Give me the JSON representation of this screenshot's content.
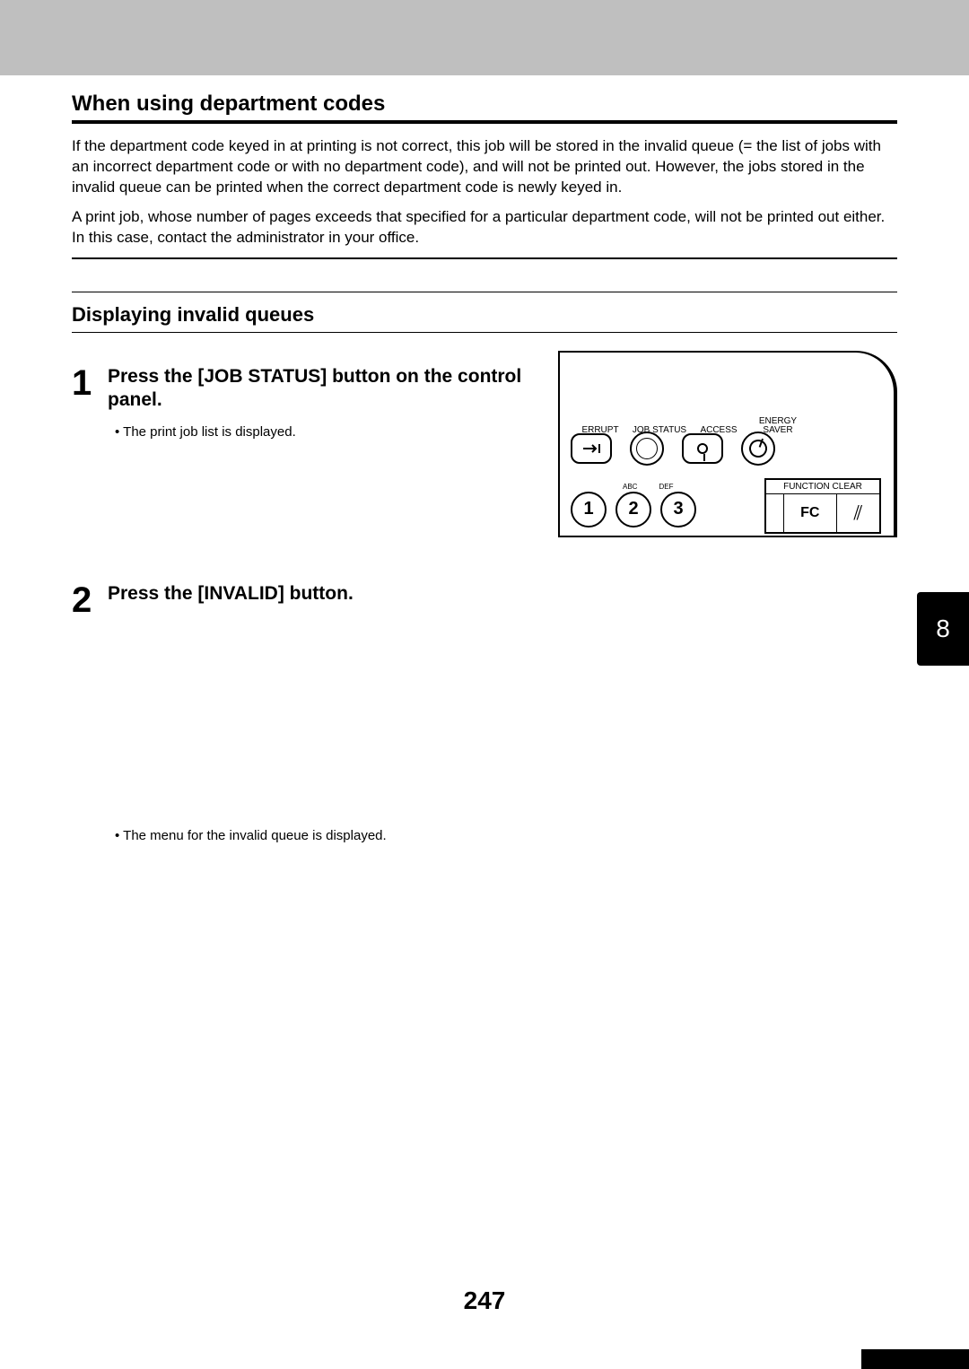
{
  "section": {
    "title": "When using department codes",
    "para1": "If the department code keyed in at printing is not correct, this job will be stored in the invalid queue (= the list of jobs with an incorrect department code or with no department code), and will not be printed out. However, the jobs stored in the invalid queue can be printed when the correct department code is newly keyed in.",
    "para2": "A print job, whose number of pages exceeds that specified for a particular department code, will not be printed out either. In this case, contact the administrator in your office."
  },
  "subsection": {
    "title": "Displaying invalid queues"
  },
  "step1": {
    "num": "1",
    "title": "Press the [JOB STATUS] button on the control panel.",
    "bullet": "The print job list is displayed."
  },
  "panel": {
    "labels": {
      "errupt": "ERRUPT",
      "jobstatus": "JOB STATUS",
      "access": "ACCESS",
      "energy1": "ENERGY",
      "energy2": "SAVER"
    },
    "tiny": {
      "abc": "ABC",
      "def": "DEF"
    },
    "nums": {
      "n1": "1",
      "n2": "2",
      "n3": "3"
    },
    "fc": {
      "label": "FUNCTION CLEAR",
      "btn": "FC",
      "clear": "⫽"
    }
  },
  "step2": {
    "num": "2",
    "title": "Press the [INVALID] button.",
    "bullet": "The menu for the invalid queue is displayed."
  },
  "sideTab": "8",
  "pageNum": "247"
}
